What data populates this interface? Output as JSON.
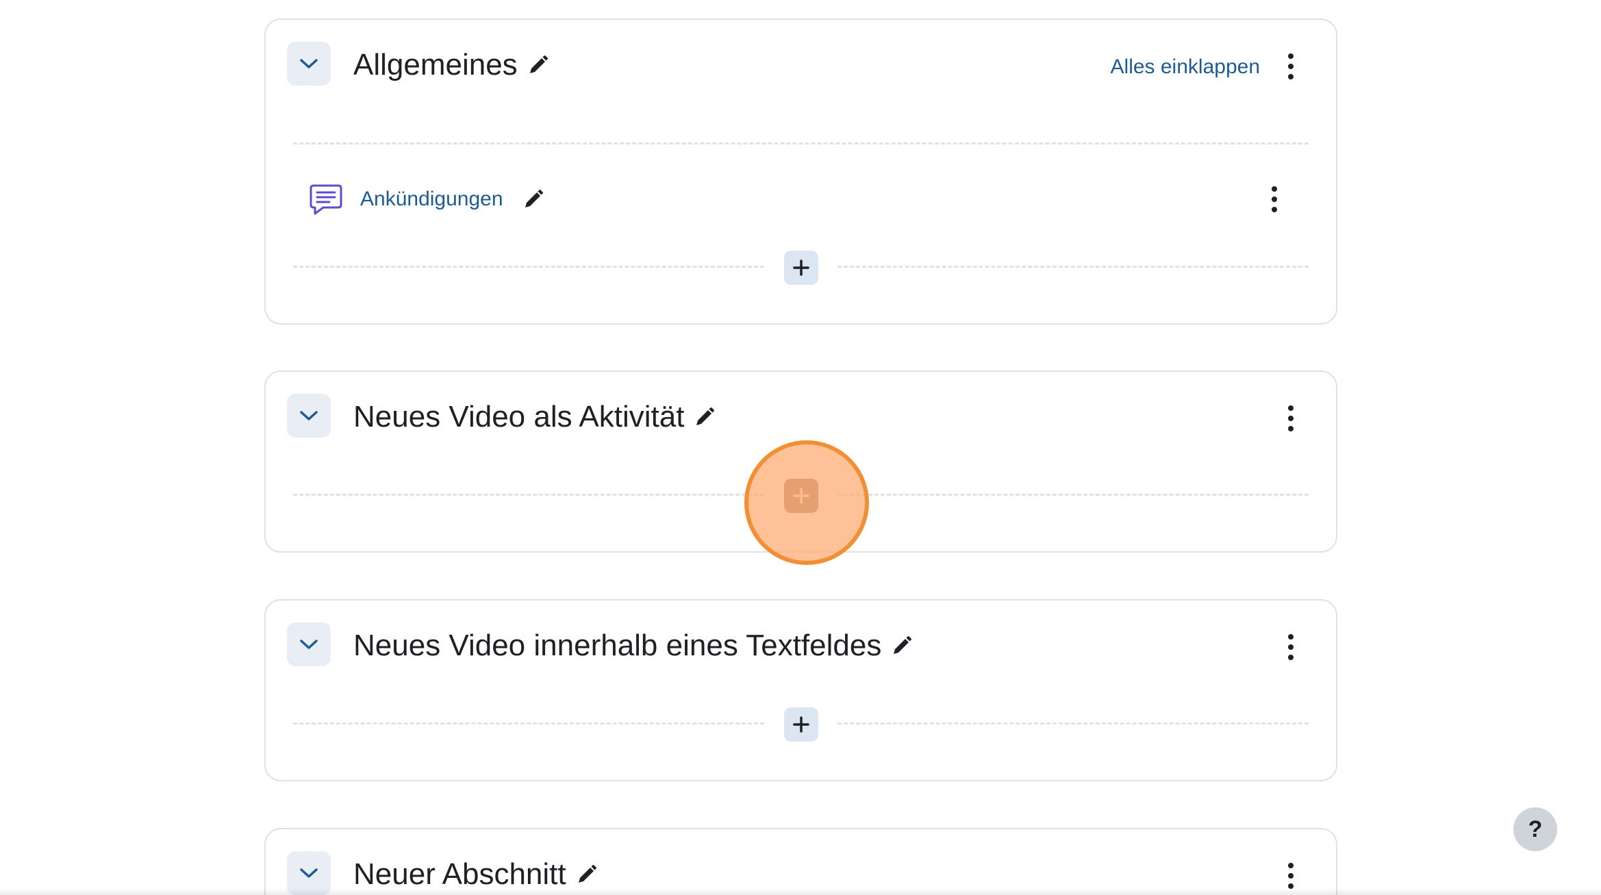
{
  "sections": [
    {
      "title": "Allgemeines",
      "collapse_all_label": "Alles einklappen",
      "activities": [
        {
          "name": "Ankündigungen",
          "icon": "forum-icon"
        }
      ]
    },
    {
      "title": "Neues Video als Aktivität"
    },
    {
      "title": "Neues Video innerhalb eines Textfeldes"
    },
    {
      "title": "Neuer Abschnitt"
    }
  ],
  "help": {
    "label": "?"
  },
  "colors": {
    "link": "#1f5b93",
    "forum_icon": "#5b4ec8",
    "highlight_fill": "#ffb078",
    "highlight_border": "#f28f35",
    "add_button": "#dbe6f2"
  }
}
